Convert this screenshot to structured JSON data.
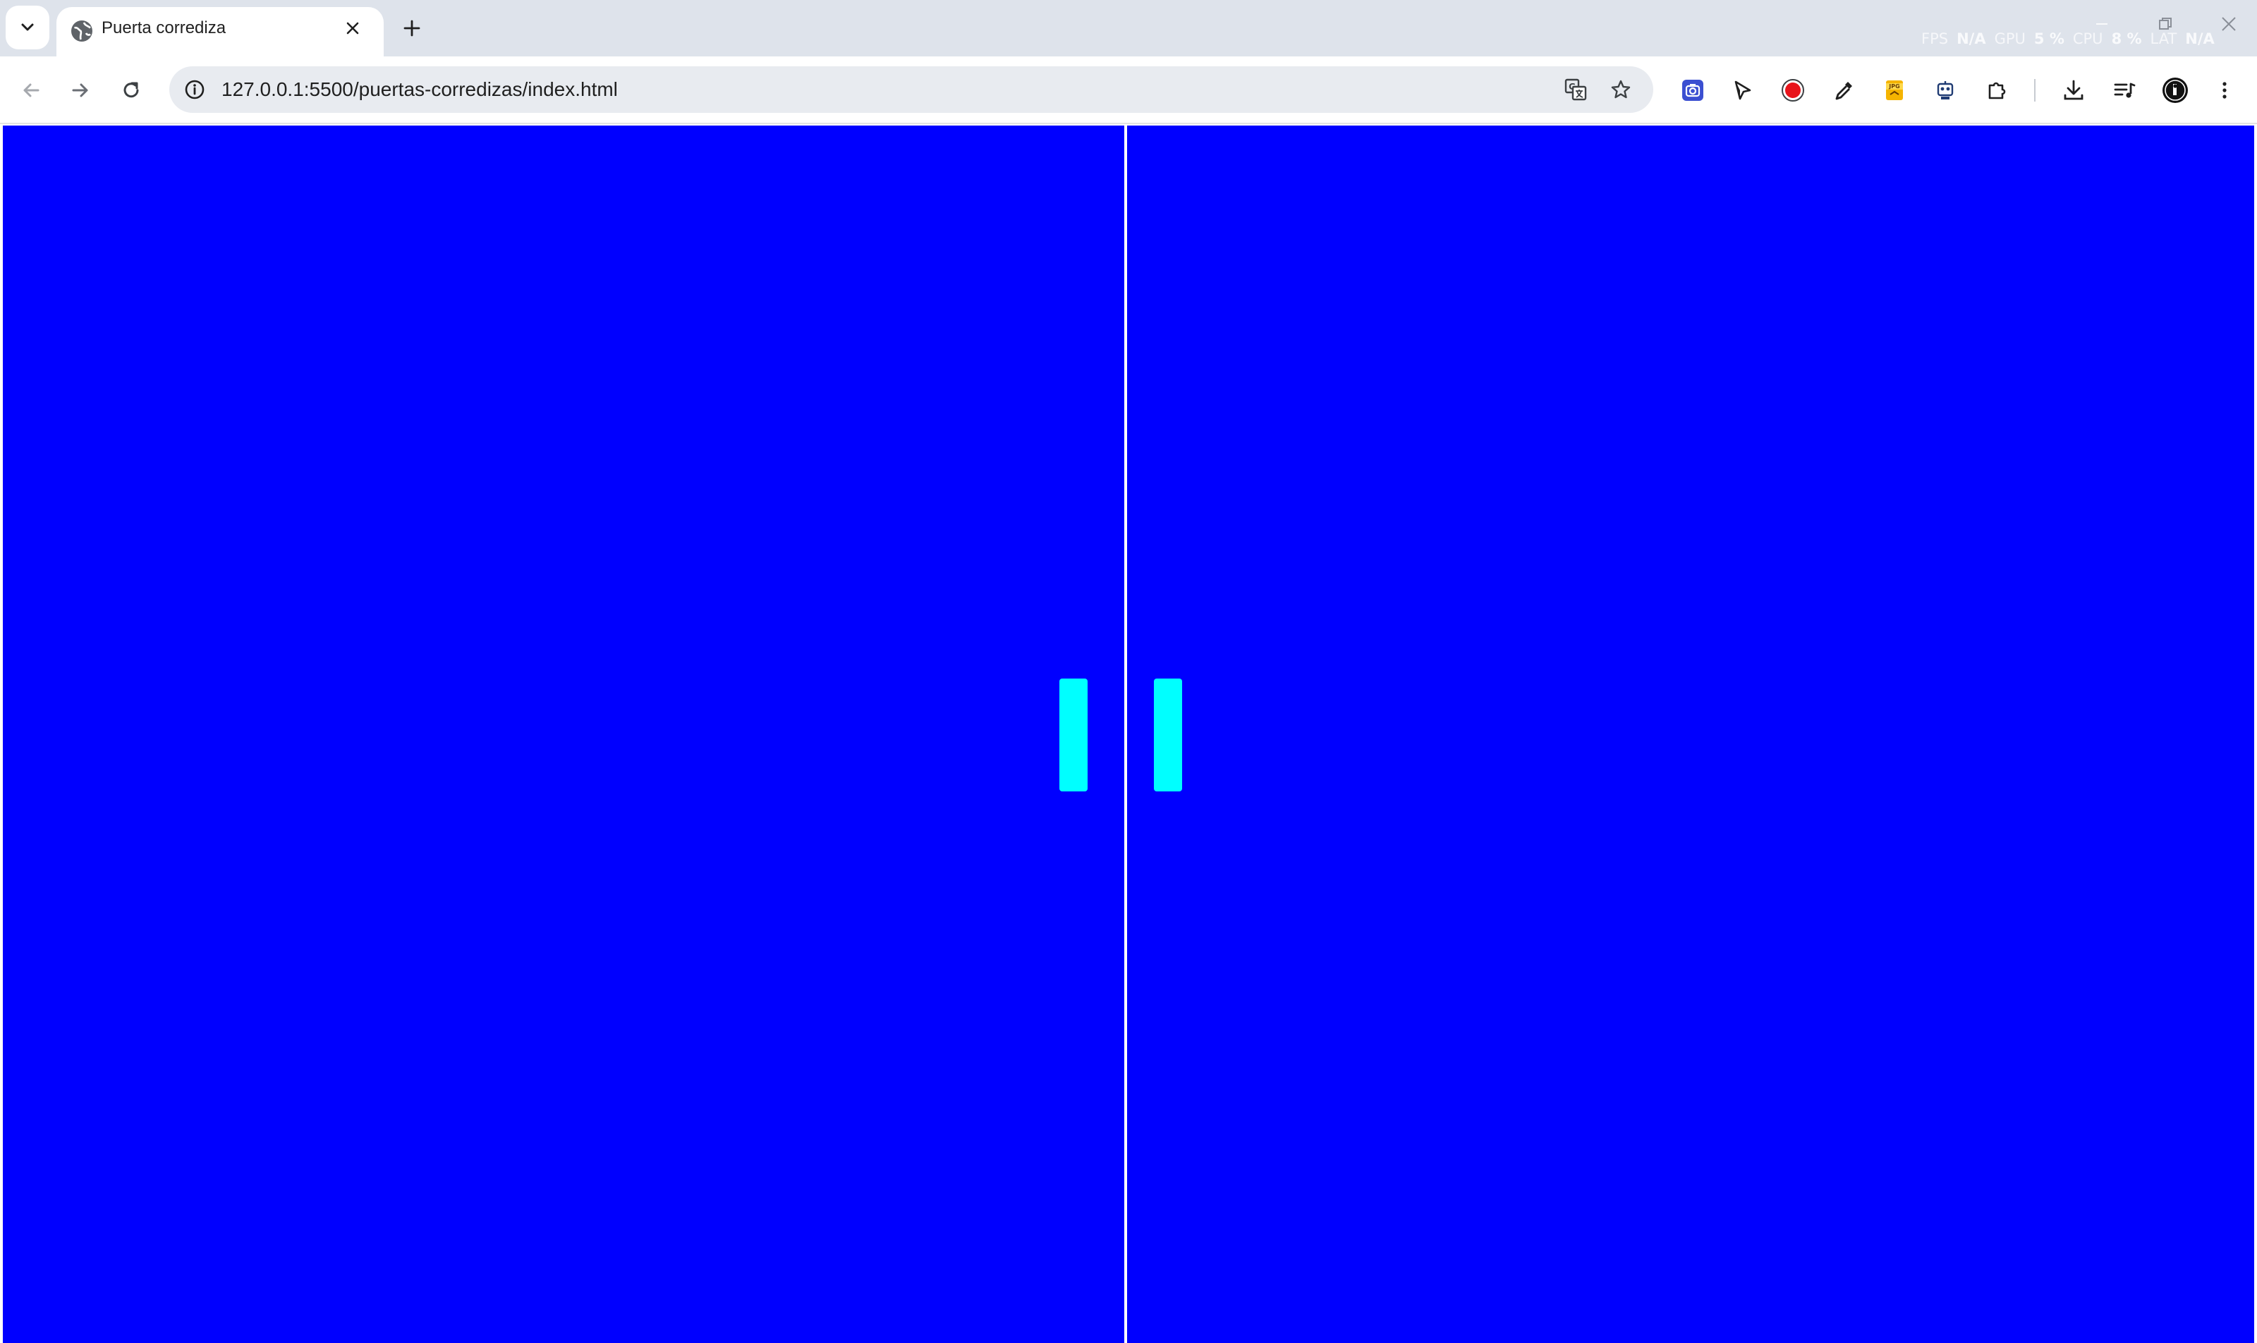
{
  "browser": {
    "tab": {
      "title": "Puerta corrediza",
      "favicon": "globe-icon"
    },
    "new_tab_icon": "plus-icon",
    "overlay": {
      "fps_label": "FPS",
      "fps_value": "N/A",
      "gpu_label": "GPU",
      "gpu_value": "5 %",
      "cpu_label": "CPU",
      "cpu_value": "8 %",
      "lat_label": "LAT",
      "lat_value": "N/A"
    },
    "address_bar": {
      "url": "127.0.0.1:5500/puertas-corredizas/index.html"
    },
    "toolbar_icons": [
      "back-icon",
      "forward-icon",
      "reload-icon",
      "site-info-icon",
      "translate-icon",
      "bookmark-star-icon",
      "camera-extension-icon",
      "cursor-extension-icon",
      "record-extension-icon",
      "eyedropper-extension-icon",
      "jpg-extension-icon",
      "robot-extension-icon",
      "extensions-puzzle-icon",
      "downloads-icon",
      "media-queue-icon",
      "profile-icon",
      "menu-icon"
    ]
  },
  "page": {
    "background_color": "#0000ff",
    "handle_color": "#00ffff",
    "divider_color": "#ffffff",
    "doors": [
      "left-door",
      "right-door"
    ]
  }
}
